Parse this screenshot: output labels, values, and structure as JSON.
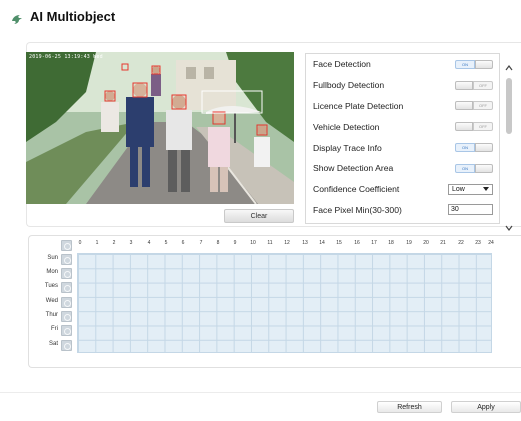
{
  "header": {
    "title": "AI Multiobject",
    "logo_icon": "dolphin-logo-icon"
  },
  "video": {
    "timestamp": "2019-06-25 13:19:43 Wed",
    "scene": "street-people-detection"
  },
  "clear_label": "Clear",
  "settings": {
    "face_detection": {
      "label": "Face Detection",
      "state": "ON"
    },
    "fullbody_detection": {
      "label": "Fullbody Detection",
      "state": "OFF"
    },
    "licence_plate_detection": {
      "label": "Licence Plate Detection",
      "state": "OFF"
    },
    "vehicle_detection": {
      "label": "Vehicle Detection",
      "state": "OFF"
    },
    "display_trace_info": {
      "label": "Display Trace Info",
      "state": "ON"
    },
    "show_detection_area": {
      "label": "Show Detection Area",
      "state": "ON"
    },
    "confidence_coefficient": {
      "label": "Confidence Coefficient",
      "value": "Low"
    },
    "face_pixel_min": {
      "label": "Face Pixel Min(30-300)",
      "value": "30"
    }
  },
  "schedule": {
    "hours": [
      "0",
      "1",
      "2",
      "3",
      "4",
      "5",
      "6",
      "7",
      "8",
      "9",
      "10",
      "11",
      "12",
      "13",
      "14",
      "15",
      "16",
      "17",
      "18",
      "19",
      "20",
      "21",
      "22",
      "23",
      "24"
    ],
    "days": [
      "Sun",
      "Mon",
      "Tues",
      "Wed",
      "Thur",
      "Fri",
      "Sat"
    ]
  },
  "footer": {
    "refresh_label": "Refresh",
    "apply_label": "Apply"
  },
  "colors": {
    "grid_fill": "#e3eef6",
    "grid_line": "#c4d7e6",
    "toggle_on": "#3a78c2",
    "detection_box": "#e8352c"
  }
}
